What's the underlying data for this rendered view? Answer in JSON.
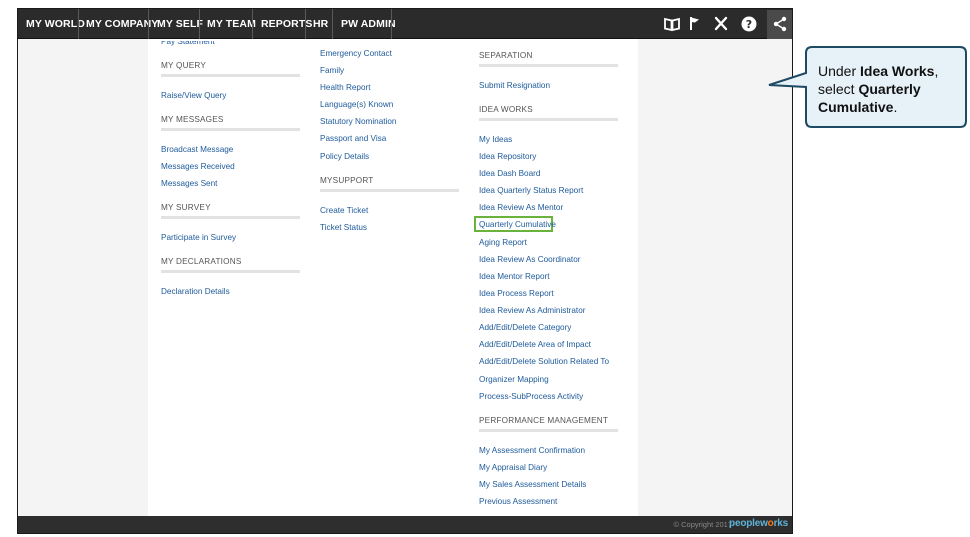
{
  "nav": {
    "items": [
      "MY WORLD",
      "MY COMPANY",
      "MY SELF",
      "MY TEAM",
      "REPORTS",
      "HR",
      "PW ADMIN"
    ],
    "toolbar_icons": [
      "book-icon",
      "flag-icon",
      "tools-icon",
      "help-icon",
      "share-icon"
    ]
  },
  "col1": {
    "cut_text": "Pay Statement",
    "sections": [
      {
        "heading": "MY QUERY",
        "links": [
          "Raise/View Query"
        ]
      },
      {
        "heading": "MY MESSAGES",
        "links": [
          "Broadcast Message",
          "Messages Received",
          "Messages Sent"
        ]
      },
      {
        "heading": "MY SURVEY",
        "links": [
          "Participate in Survey"
        ]
      },
      {
        "heading": "MY DECLARATIONS",
        "links": [
          "Declaration Details"
        ]
      }
    ]
  },
  "col2": {
    "links_top": [
      "Emergency Contact",
      "Family",
      "Health Report",
      "Language(s) Known",
      "Statutory Nomination",
      "Passport and Visa",
      "Policy Details"
    ],
    "sections": [
      {
        "heading": "MYSUPPORT",
        "links": [
          "Create Ticket",
          "Ticket Status"
        ]
      }
    ]
  },
  "col3": {
    "sections": [
      {
        "heading": "SEPARATION",
        "links": [
          "Submit Resignation"
        ]
      },
      {
        "heading": "IDEA WORKS",
        "links": [
          "My Ideas",
          "Idea Repository",
          "Idea Dash Board",
          "Idea Quarterly Status Report",
          "Idea Review As Mentor",
          "Quarterly Cumulative",
          "Aging Report",
          "Idea Review As Coordinator",
          "Idea Mentor Report",
          "Idea Process Report",
          "Idea Review As Administrator",
          "Add/Edit/Delete Category",
          "Add/Edit/Delete Area of Impact",
          "Add/Edit/Delete Solution Related To",
          "Organizer Mapping",
          "Process-SubProcess Activity"
        ]
      },
      {
        "heading": "PERFORMANCE MANAGEMENT",
        "links": [
          "My Assessment Confirmation",
          "My Appraisal Diary",
          "My Sales Assessment Details",
          "Previous Assessment"
        ]
      }
    ],
    "highlighted": "Quarterly Cumulative"
  },
  "footer": {
    "copyright": "© Copyright 2017",
    "brand_a": "peoplew",
    "brand_b": "o",
    "brand_c": "rks"
  },
  "callout": {
    "t1": "Under ",
    "b1": "Idea Works",
    "t2": ", select ",
    "b2": "Quarterly Cumulative",
    "t3": "."
  },
  "colors": {
    "nav_bg": "#2b2b2b",
    "link": "#1e5a9a",
    "highlight": "#69b33d",
    "callout_fill": "#e6f1f8",
    "callout_stroke": "#1f4a63"
  }
}
